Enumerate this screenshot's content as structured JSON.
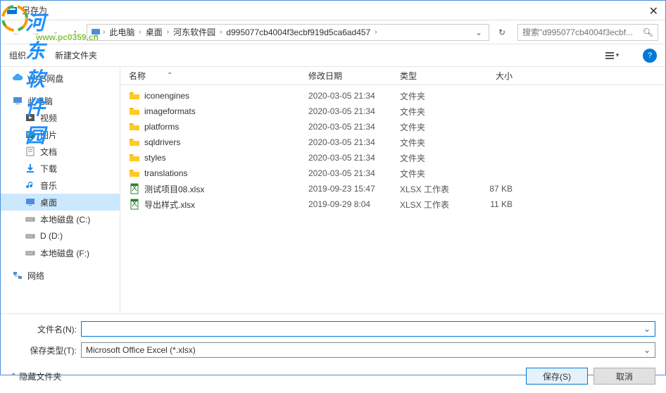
{
  "window": {
    "title": "另存为"
  },
  "watermark": {
    "text": "河东软件园",
    "url": "www.pc0359.cn"
  },
  "breadcrumb": {
    "items": [
      "此电脑",
      "桌面",
      "河东软件园",
      "d995077cb4004f3ecbf919d5ca6ad457"
    ]
  },
  "search": {
    "placeholder": "搜索\"d995077cb4004f3ecbf..."
  },
  "toolbar": {
    "organize": "组织",
    "newfolder": "新建文件夹"
  },
  "sidebar": {
    "items": [
      {
        "label": "WPS网盘",
        "icon": "cloud",
        "indent": 0
      },
      {
        "label": "此电脑",
        "icon": "pc",
        "indent": 0
      },
      {
        "label": "视频",
        "icon": "video",
        "indent": 1
      },
      {
        "label": "图片",
        "icon": "picture",
        "indent": 1
      },
      {
        "label": "文档",
        "icon": "doc",
        "indent": 1
      },
      {
        "label": "下载",
        "icon": "download",
        "indent": 1
      },
      {
        "label": "音乐",
        "icon": "music",
        "indent": 1
      },
      {
        "label": "桌面",
        "icon": "desktop",
        "indent": 1,
        "selected": true
      },
      {
        "label": "本地磁盘 (C:)",
        "icon": "drive",
        "indent": 1
      },
      {
        "label": "D (D:)",
        "icon": "drive",
        "indent": 1
      },
      {
        "label": "本地磁盘 (F:)",
        "icon": "drive",
        "indent": 1
      },
      {
        "label": "网络",
        "icon": "network",
        "indent": 0
      }
    ]
  },
  "columns": {
    "name": "名称",
    "date": "修改日期",
    "type": "类型",
    "size": "大小"
  },
  "rows": [
    {
      "name": "iconengines",
      "date": "2020-03-05 21:34",
      "type": "文件夹",
      "size": "",
      "icon": "folder"
    },
    {
      "name": "imageformats",
      "date": "2020-03-05 21:34",
      "type": "文件夹",
      "size": "",
      "icon": "folder"
    },
    {
      "name": "platforms",
      "date": "2020-03-05 21:34",
      "type": "文件夹",
      "size": "",
      "icon": "folder"
    },
    {
      "name": "sqldrivers",
      "date": "2020-03-05 21:34",
      "type": "文件夹",
      "size": "",
      "icon": "folder"
    },
    {
      "name": "styles",
      "date": "2020-03-05 21:34",
      "type": "文件夹",
      "size": "",
      "icon": "folder"
    },
    {
      "name": "translations",
      "date": "2020-03-05 21:34",
      "type": "文件夹",
      "size": "",
      "icon": "folder"
    },
    {
      "name": "测试项目08.xlsx",
      "date": "2019-09-23 15:47",
      "type": "XLSX 工作表",
      "size": "87 KB",
      "icon": "xlsx"
    },
    {
      "name": "导出样式.xlsx",
      "date": "2019-09-29 8:04",
      "type": "XLSX 工作表",
      "size": "11 KB",
      "icon": "xlsx"
    }
  ],
  "form": {
    "filename_label": "文件名(N):",
    "filename_value": "",
    "filetype_label": "保存类型(T):",
    "filetype_value": "Microsoft Office Excel (*.xlsx)"
  },
  "footer": {
    "hide_folders": "隐藏文件夹",
    "save": "保存(S)",
    "cancel": "取消"
  }
}
